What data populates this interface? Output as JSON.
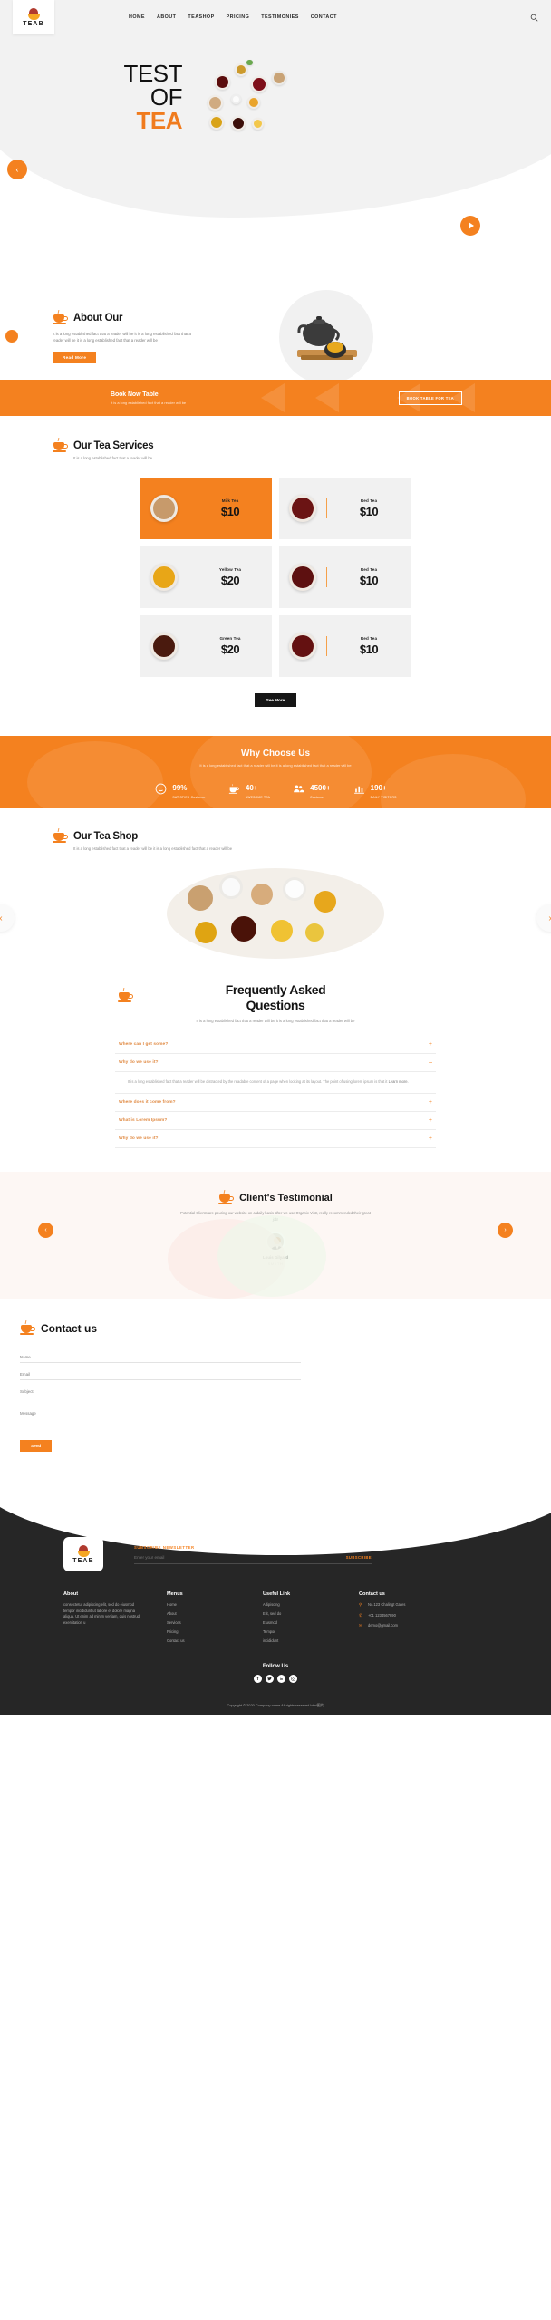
{
  "brand": {
    "name": "TEAB",
    "logo_icon": "tea-logo-icon"
  },
  "nav": {
    "items": [
      {
        "label": "HOME"
      },
      {
        "label": "ABOUT"
      },
      {
        "label": "TEASHOP"
      },
      {
        "label": "PRICING"
      },
      {
        "label": "TESTIMONIES"
      },
      {
        "label": "CONTACT"
      }
    ],
    "search_icon": "search-icon"
  },
  "hero": {
    "line1": "TEST",
    "line2": "OF",
    "line3": "TEA",
    "prev_icon": "chevron-left-icon",
    "play_icon": "play-icon"
  },
  "about": {
    "title": "About Our",
    "body": "It is a long established fact that a reader will be it is a long established fact that a reader will be it is a long established fact that a reader will be",
    "button": "Read More"
  },
  "book_band": {
    "title": "Book Now Table",
    "subtitle": "It is a long established fact that a reader will be",
    "button": "BOOK TABLE FOR TEA"
  },
  "services": {
    "title": "Our Tea Services",
    "subtitle": "It is a long established fact that a reader will be",
    "see_more": "See More",
    "cards": [
      {
        "name": "Milk Tea",
        "price": "$10",
        "active": true,
        "color": "#c79a6b"
      },
      {
        "name": "Red Tea",
        "price": "$10",
        "active": false,
        "color": "#6b1414"
      },
      {
        "name": "Yellow Tea",
        "price": "$20",
        "active": false,
        "color": "#e8a617"
      },
      {
        "name": "Red Tea",
        "price": "$10",
        "active": false,
        "color": "#5d1010"
      },
      {
        "name": "Green Tea",
        "price": "$20",
        "active": false,
        "color": "#4a1a0e"
      },
      {
        "name": "Red Tea",
        "price": "$10",
        "active": false,
        "color": "#641111"
      }
    ]
  },
  "why": {
    "title": "Why Choose Us",
    "subtitle": "It is a long established fact that a reader will be it is a long established fact that a reader will be",
    "stats": [
      {
        "icon": "smiley-icon",
        "value": "99%",
        "label": "SATISFIED Customer"
      },
      {
        "icon": "teacup-icon",
        "value": "40+",
        "label": "AWESOME TEA"
      },
      {
        "icon": "users-icon",
        "value": "4500+",
        "label": "Customer"
      },
      {
        "icon": "chart-icon",
        "value": "190+",
        "label": "DAILY VISITORS"
      }
    ]
  },
  "shop": {
    "title": "Our Tea Shop",
    "subtitle": "It is a long established fact that a reader will be it is a long established fact that a reader will be",
    "prev_icon": "chevron-left-icon",
    "next_icon": "chevron-right-icon"
  },
  "faq": {
    "title_line1": "Frequently Asked",
    "title_line2": "Questions",
    "subtitle": "It is a long established fact that a reader will be it is a long established fact that a reader will be",
    "items": [
      {
        "question": "Where can I get some?",
        "sign": "+",
        "open": false
      },
      {
        "question": "Why do we use it?",
        "sign": "–",
        "open": true,
        "answer": "It is a long established fact that a reader will be distracted by the readable content of a page when looking at its layout. The point of using lorem ipsum is that it ",
        "answer_link": "Learn more."
      },
      {
        "question": "Where does it come from?",
        "sign": "+",
        "open": false
      },
      {
        "question": "What is Lorem Ipsum?",
        "sign": "+",
        "open": false
      },
      {
        "question": "Why do we use it?",
        "sign": "+",
        "open": false
      }
    ]
  },
  "testimonial": {
    "title": "Client's Testimonial",
    "quote": "Potential Clients are pouring our website on a daily basis after we use Organic Vistr, really recommended their great job!",
    "name": "Louis Gilyard",
    "role": "SMYTH",
    "prev_icon": "chevron-left-icon",
    "next_icon": "chevron-right-icon"
  },
  "contact": {
    "title": "Contact us",
    "fields": {
      "name": "Name",
      "email": "Email",
      "subject": "Subject",
      "message": "Message"
    },
    "send": "Send"
  },
  "footer": {
    "newsletter": {
      "label": "SUBSCRIBE NEWSLETTER",
      "placeholder": "Enter your email",
      "button": "SUBSCRIBE"
    },
    "about": {
      "heading": "About",
      "text": "consectetur adipiscing elit, sed do eiusmod tempor incididunt ut labore et dolore magna aliqua. Ut enim ad minim veniam, quis nostrud exercitation u"
    },
    "menus": {
      "heading": "Menus",
      "items": [
        "Home",
        "About",
        "Services",
        "Pricing",
        "Contact us"
      ]
    },
    "useful": {
      "heading": "Useful Link",
      "items": [
        "Adipiscing",
        "Elit, sed do",
        "Eiusmod",
        "Tempor",
        "incididunt"
      ]
    },
    "contact": {
      "heading": "Contact us",
      "address": "No.123 Chalingt Gates",
      "phone": "+01 1234567890",
      "email": "demo@gmail.com",
      "address_icon": "location-pin-icon",
      "phone_icon": "phone-icon",
      "email_icon": "envelope-icon"
    },
    "follow": {
      "heading": "Follow Us",
      "socials": [
        {
          "icon": "facebook-icon",
          "glyph": "f"
        },
        {
          "icon": "twitter-icon",
          "glyph": "ᵗ"
        },
        {
          "icon": "linkedin-icon",
          "glyph": "in"
        },
        {
          "icon": "instagram-icon",
          "glyph": "□"
        }
      ]
    },
    "copyright": "Copyright © 2020 Company name All rights reserved html图片"
  }
}
